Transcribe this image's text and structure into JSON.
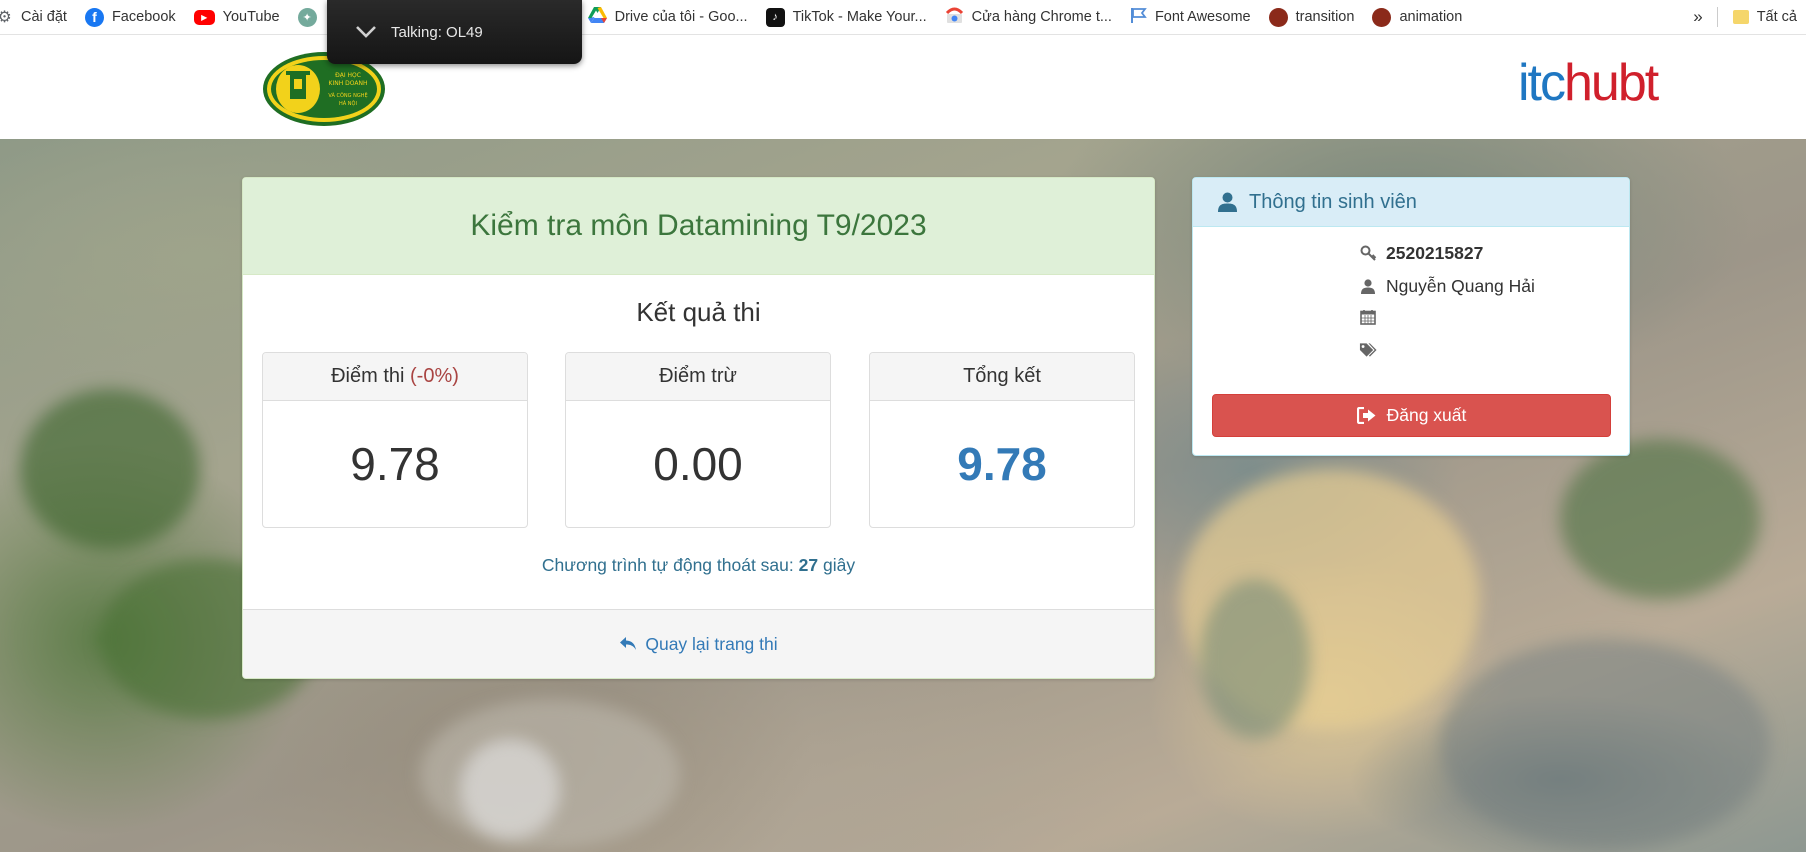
{
  "bookmarks": {
    "items": [
      {
        "label": "Cài đặt",
        "icon": "gear-icon"
      },
      {
        "label": "Facebook",
        "icon": "facebook-icon",
        "color": "#1877f2"
      },
      {
        "label": "YouTube",
        "icon": "youtube-icon",
        "color": "#ff0000"
      },
      {
        "label": "Drive của tôi - Goo...",
        "icon": "google-drive-icon"
      },
      {
        "label": "TikTok - Make Your...",
        "icon": "tiktok-icon"
      },
      {
        "label": "Cửa hàng Chrome t...",
        "icon": "chrome-web-store-icon"
      },
      {
        "label": "Font Awesome",
        "icon": "font-awesome-flag-icon",
        "color": "#538dd7"
      },
      {
        "label": "transition",
        "icon": "avatar-icon"
      },
      {
        "label": "animation",
        "icon": "avatar-icon"
      }
    ],
    "more": "»",
    "all_bookmarks": "Tất cả"
  },
  "tooltip": {
    "label": "Talking: OL49"
  },
  "header": {
    "left_logo_text": "ĐẠI HỌC KINH DOANH VÀ CÔNG NGHỆ HÀ NỘI",
    "right_logo": {
      "part1": "itc",
      "part2": "hubt"
    }
  },
  "exam": {
    "title": "Kiểm tra môn Datamining T9/2023",
    "result_title": "Kết quả thi",
    "scores": [
      {
        "label": "Điểm thi",
        "suffix": "(-0%)",
        "value": "9.78"
      },
      {
        "label": "Điểm trừ",
        "value": "0.00"
      },
      {
        "label": "Tổng kết",
        "value": "9.78"
      }
    ],
    "countdown": {
      "prefix": "Chương trình tự động thoát sau:",
      "seconds": "27",
      "suffix": "giây"
    },
    "back_label": "Quay lại trang thi"
  },
  "student": {
    "heading": "Thông tin sinh viên",
    "id": "2520215827",
    "name": "Nguyễn Quang Hải",
    "dob": "",
    "tags": "",
    "logout_label": "Đăng xuất"
  },
  "colors": {
    "success_bg": "#dff0d8",
    "success_text": "#3c763d",
    "info_bg": "#d9edf7",
    "info_text": "#31708f",
    "primary": "#337ab7",
    "danger": "#d9534f"
  }
}
